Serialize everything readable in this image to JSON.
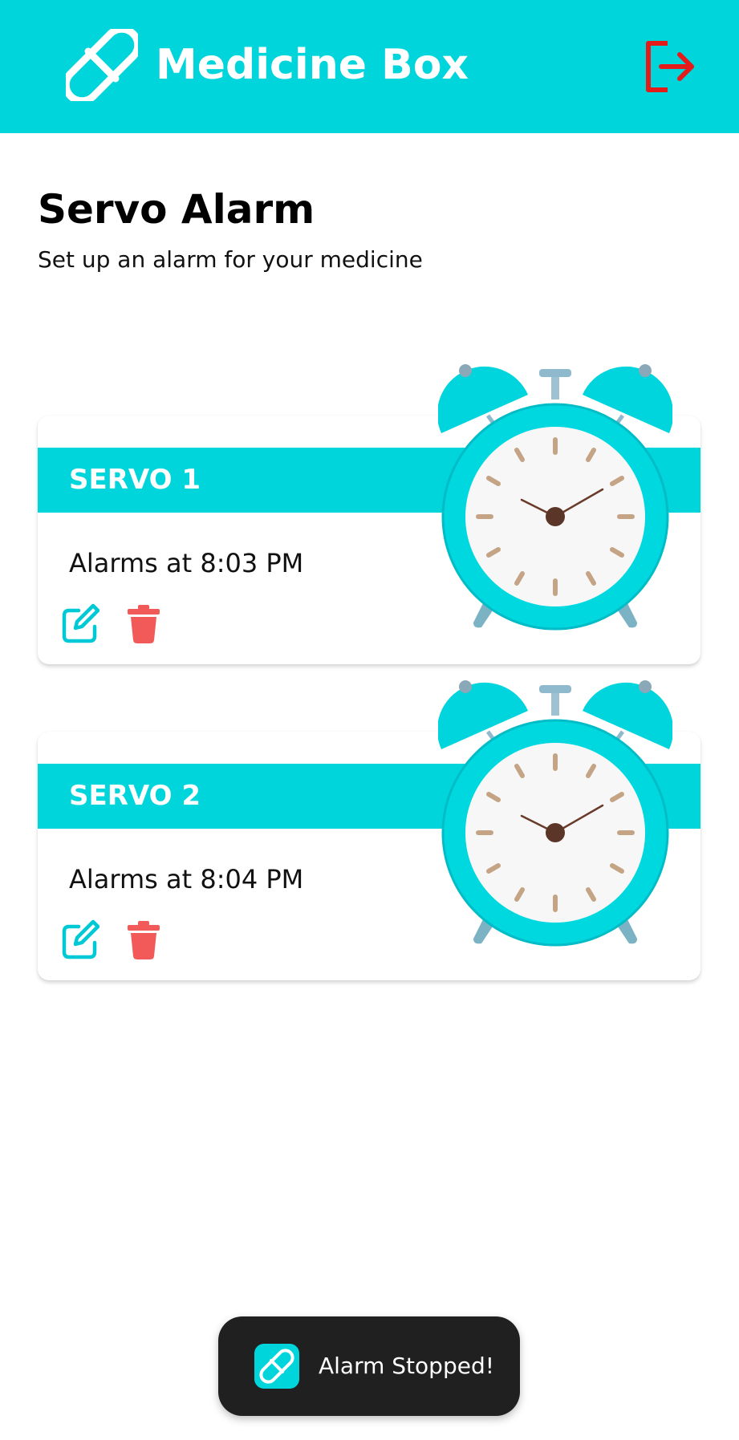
{
  "header": {
    "title": "Medicine Box",
    "logo_icon": "pill-icon",
    "logout_icon": "logout-icon"
  },
  "page": {
    "title": "Servo Alarm",
    "subtitle": "Set up an alarm for your medicine"
  },
  "alarms": [
    {
      "label": "SERVO 1",
      "time_text": "Alarms at 8:03 PM"
    },
    {
      "label": "SERVO 2",
      "time_text": "Alarms at 8:04 PM"
    }
  ],
  "actions": {
    "edit_icon": "edit-icon",
    "delete_icon": "trash-icon"
  },
  "toast": {
    "message": "Alarm Stopped!",
    "icon": "pill-icon"
  },
  "colors": {
    "accent": "#00d5dc",
    "logout": "#e31b1b",
    "delete": "#f25a5a",
    "edit": "#00c9d6",
    "toast_bg": "#202020"
  }
}
